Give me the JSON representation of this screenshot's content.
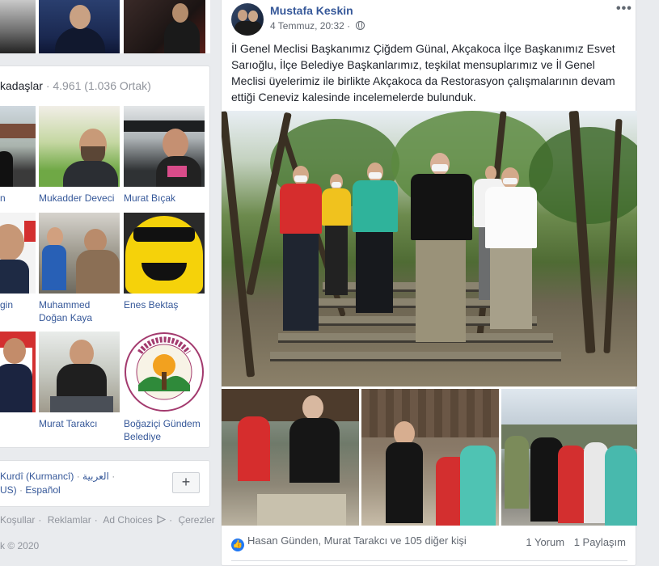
{
  "friends": {
    "header_label": "kadaşlar",
    "header_count": "4.961 (1.036 Ortak)",
    "items": [
      {
        "name": "n"
      },
      {
        "name": "Mukadder Deveci"
      },
      {
        "name": "Murat Bıçak"
      },
      {
        "name": "gin"
      },
      {
        "name": "Muhammed Doğan Kaya"
      },
      {
        "name": "Enes Bektaş"
      },
      {
        "name": ""
      },
      {
        "name": "Murat Tarakcı"
      },
      {
        "name": "Boğaziçi Gündem Belediye"
      }
    ]
  },
  "languages": {
    "line1_a": "Kurdî (Kurmancî)",
    "line1_sep": "·",
    "line1_b": "العربية",
    "line1_end": "·",
    "line2_a": "US)",
    "line2_sep": "·",
    "line2_b": "Español",
    "add_button": "+"
  },
  "footer": {
    "links": [
      "Koşullar",
      "Reklamlar",
      "Ad Choices",
      "Çerezler"
    ],
    "separator": "·",
    "copyright": "k © 2020"
  },
  "post": {
    "author": "Mustafa Keskin",
    "timestamp": "4 Temmuz, 20:32",
    "separator": "·",
    "more_label": "•••",
    "text": "İl Genel Meclisi Başkanımız Çiğdem Günal, Akçakoca İlçe Başkanımız Esvet Sarıoğlu, İlçe Belediye Başkanlarımız, teşkilat mensuplarımız ve İl Genel Meclisi üyelerimiz ile birlikte Akçakoca da Restorasyon çalışmalarının devam ettiği Ceneviz kalesinde incelemelerde bulunduk.",
    "reactions_text": "Hasan Günden, Murat Tarakcı ve 105 diğer kişi",
    "comments_label": "1 Yorum",
    "shares_label": "1 Paylaşım"
  },
  "logo": {
    "text_top": "BOĞAZİÇİ BELEDİYESİ",
    "year": "1994"
  },
  "colors": {
    "link": "#365899",
    "like_blue": "#2078f4",
    "page_bg": "#e9ebee"
  },
  "icons": [
    "globe-icon",
    "more-icon",
    "like-icon",
    "add-icon",
    "ad-choices-icon"
  ]
}
